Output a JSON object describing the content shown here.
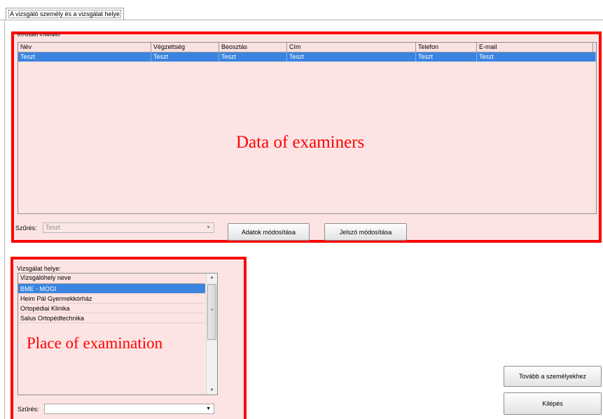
{
  "tab": {
    "label": "A vizsgáló személy és a vizsgálat helye"
  },
  "examiners": {
    "group_label": "Vizsgáló személy:",
    "columns": [
      "Név",
      "Végzettség",
      "Beosztás",
      "Cím",
      "Telefon",
      "E-mail"
    ],
    "rows": [
      [
        "Teszt",
        "Teszt",
        "Teszt",
        "Teszt",
        "Teszt",
        "Teszt"
      ]
    ],
    "overlay_label": "Data of examiners",
    "filter_label": "Szűrés:",
    "filter_value": "Teszt",
    "modify_button": "Adatok módosítása",
    "password_button": "Jelszó módosítása"
  },
  "place": {
    "group_label": "Vizsgálat helye:",
    "column": "Vizsgálóhely neve",
    "items": [
      "BME - MOGI",
      "Heim Pál Gyermekkórház",
      "Ortopédiai Klinika",
      "Salus Ortopédtechnika"
    ],
    "overlay_label": "Place of examination",
    "filter_label": "Szűrés:",
    "filter_value": ""
  },
  "buttons": {
    "next": "Tovább a személyekhez",
    "exit": "Kilépés"
  },
  "colors": {
    "highlight_border": "#ff0000",
    "highlight_fill": "#fde4e4",
    "selection": "#3a84e0"
  }
}
